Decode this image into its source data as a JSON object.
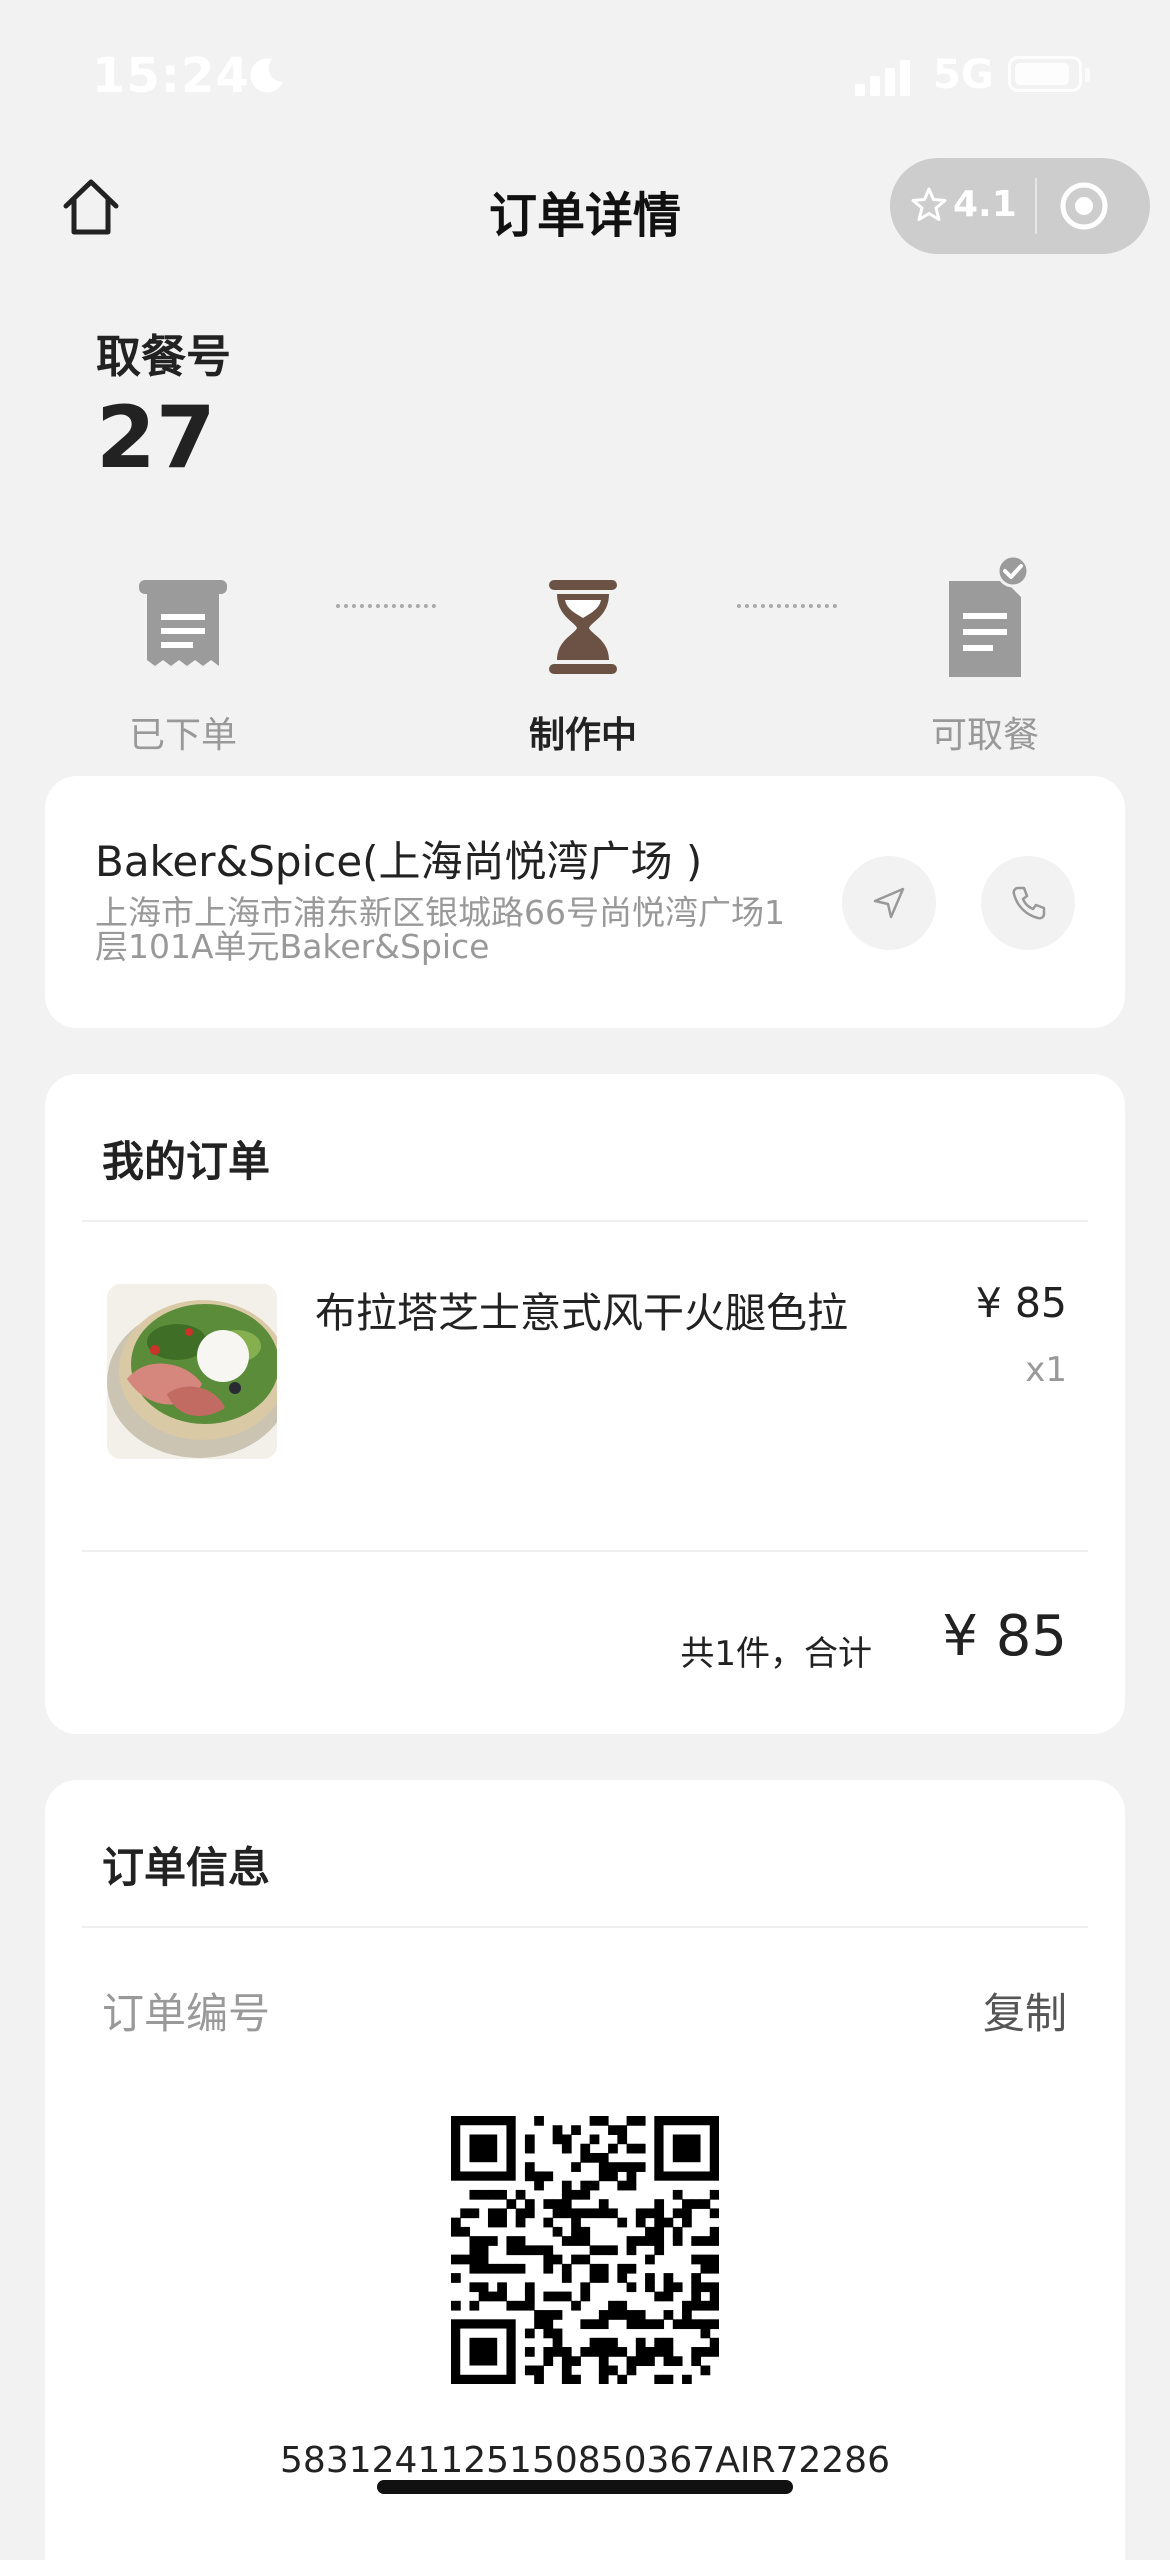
{
  "status_bar": {
    "time": "15:24",
    "network": "5G"
  },
  "nav": {
    "title": "订单详情",
    "rating": "4.1"
  },
  "pickup": {
    "label": "取餐号",
    "number": "27"
  },
  "progress": {
    "steps": [
      {
        "label": "已下单",
        "state": "done"
      },
      {
        "label": "制作中",
        "state": "active"
      },
      {
        "label": "可取餐",
        "state": "pending"
      }
    ]
  },
  "store": {
    "name": "Baker&Spice(上海尚悦湾广场 )",
    "address": "上海市上海市浦东新区银城路66号尚悦湾广场1层101A单元Baker&Spice"
  },
  "my_order": {
    "title": "我的订单",
    "items": [
      {
        "name": "布拉塔芝士意式风干火腿色拉",
        "price": "¥ 85",
        "qty": "x1"
      }
    ],
    "summary_label": "共1件，合计",
    "summary_total": "¥ 85"
  },
  "order_info": {
    "title": "订单信息",
    "order_no_label": "订单编号",
    "copy_label": "复制",
    "order_no": "58312411251508503​67AIR72286"
  },
  "colors": {
    "accent": "#6b5244",
    "muted": "#999999",
    "background": "#f2f2f2"
  }
}
